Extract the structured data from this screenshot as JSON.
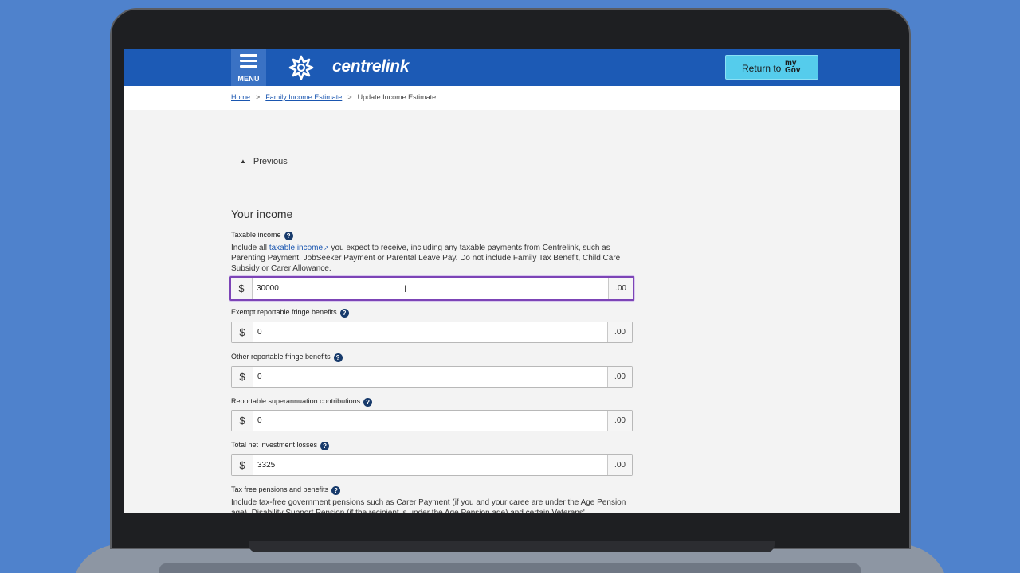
{
  "header": {
    "menu_label": "MENU",
    "brand": "centrelink",
    "return_label": "Return to",
    "mygov_line1": "my",
    "mygov_line2": "Gov"
  },
  "breadcrumb": {
    "home": "Home",
    "family": "Family Income Estimate",
    "current": "Update Income Estimate",
    "separator": ">"
  },
  "nav": {
    "previous": "Previous"
  },
  "section": {
    "title": "Your income"
  },
  "fields": [
    {
      "label": "Taxable income",
      "help_prefix": "Include all ",
      "help_link": "taxable income",
      "help_suffix": " you expect to receive, including any taxable payments from Centrelink, such as Parenting Payment, JobSeeker Payment or Parental Leave Pay. Do not include Family Tax Benefit, Child Care Subsidy or Carer Allowance.",
      "value": "30000"
    },
    {
      "label": "Exempt reportable fringe benefits",
      "value": "0"
    },
    {
      "label": "Other reportable fringe benefits",
      "value": "0"
    },
    {
      "label": "Reportable superannuation contributions",
      "value": "0"
    },
    {
      "label": "Total net investment losses",
      "value": "3325"
    },
    {
      "label": "Tax free pensions and benefits",
      "help": "Include tax-free government pensions such as Carer Payment (if you and your caree are under the Age Pension age), Disability Support Pension (if the recipient is under the Age Pension age) and certain Veterans'"
    }
  ],
  "common": {
    "currency": "$",
    "cents": ".00",
    "help_icon": "?"
  },
  "icons": {
    "menu": "hamburger-icon",
    "logo": "centrelink-star-icon",
    "previous": "chevron-up-icon",
    "help": "question-circle-icon",
    "external": "external-link-icon",
    "cursor": "text-cursor-icon"
  },
  "colors": {
    "header": "#1c5ab5",
    "return_button": "#55ccec",
    "focus": "#7c44b6",
    "link": "#1a56b0",
    "background": "#4f82cc"
  }
}
